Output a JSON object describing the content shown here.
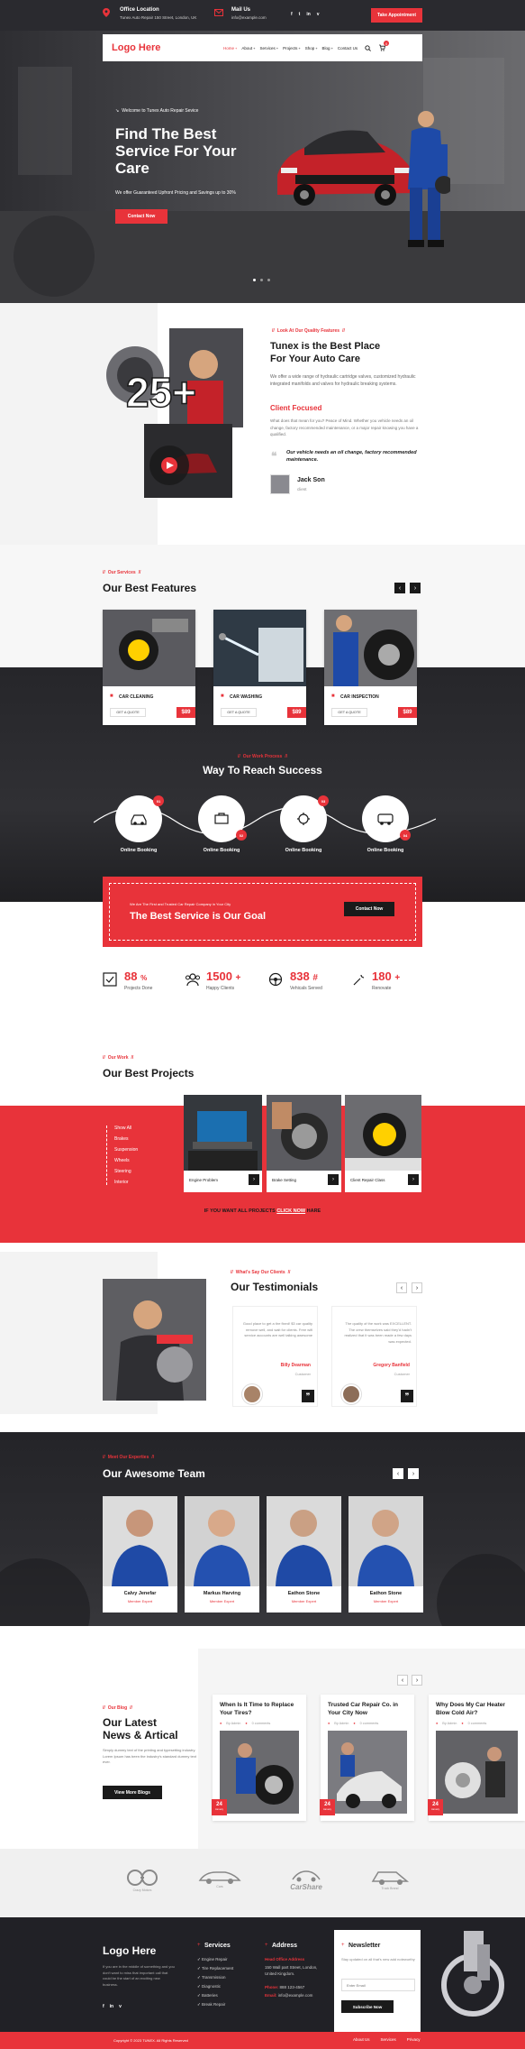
{
  "topbar": {
    "office_title": "Office Location",
    "office_text": "Tunex Auto Repair 150 Street, London, UK",
    "mail_title": "Mail Us",
    "mail_text": "info@example.com",
    "social": [
      "f",
      "t",
      "in",
      "v"
    ],
    "appointment": "Take Appointment"
  },
  "nav": {
    "logo": "Logo Here",
    "items": [
      "Home",
      "About",
      "Services",
      "Projects",
      "Shop",
      "Blog",
      "Contact Us"
    ],
    "cart_count": "0"
  },
  "hero": {
    "tag": "Welcome to Tunex Auto Repair Sevice",
    "title1": "Find The Best",
    "title2": "Service For Your",
    "title3": "Care",
    "sub": "We offer Guaranteed Upfront Pricing and Savings up to 30%",
    "button": "Contact Now"
  },
  "about": {
    "badge": "25+",
    "tag": "Look At Our Quality Features",
    "title1": "Tunex is the Best Place",
    "title2": "For Your Auto Care",
    "desc": "We offer a wide range of hydraulic cartridge valves, customized hydraulic integrated manifolds and valves for hydraulic breaking systems.",
    "subhead": "Client Focused",
    "desc2": "What does that mean for you? Peace of Mind. Whether you vehicle needs an oil change, factory recommended maintenance, or a major repair knowing you have a qualified.",
    "quote": "Our vehicle needs an oil change, factory recommended maintenance.",
    "author": "Jack Son",
    "author_role": "client"
  },
  "services": {
    "tag": "Our Services",
    "title": "Our Best Features",
    "cards": [
      {
        "name": "CAR CLEANING",
        "btn": "GET A QUOTE",
        "price": "$89"
      },
      {
        "name": "CAR WASHING",
        "btn": "GET A QUOTE",
        "price": "$89"
      },
      {
        "name": "CAR INSPECTION",
        "btn": "GET A QUOTE",
        "price": "$89"
      }
    ]
  },
  "process": {
    "tag": "Our Work Process",
    "title": "Way To Reach Success",
    "steps": [
      {
        "label": "Online Booking",
        "num": "01"
      },
      {
        "label": "Online Booking",
        "num": "02"
      },
      {
        "label": "Online Booking",
        "num": "03"
      },
      {
        "label": "Online Booking",
        "num": "04"
      }
    ]
  },
  "cta": {
    "small": "We Are The First and Trusted Car Repair Company in Your City",
    "title": "The Best Service is Our Goal",
    "button": "Contact Now"
  },
  "stats": [
    {
      "num": "88",
      "unit": "%",
      "label": "Projects Done"
    },
    {
      "num": "1500",
      "unit": "+",
      "label": "Happy Clients"
    },
    {
      "num": "838",
      "unit": "#",
      "label": "Vehicals Served"
    },
    {
      "num": "180",
      "unit": "+",
      "label": "Renovate"
    }
  ],
  "projects": {
    "tag": "Our Work",
    "title": "Our Best Projects",
    "filters": [
      "Show All",
      "Brakes",
      "Suspension",
      "Wheels",
      "Steering",
      "Interior"
    ],
    "items": [
      "Engine Problem",
      "Brake Setting",
      "Client Repair Class"
    ],
    "more_text": "IF YOU WANT ALL PROJECTS",
    "more_link": "CLICK NOW",
    "more_end": "HARE"
  },
  "testimonials": {
    "tag": "What's Say Our Clients",
    "title": "Our Testimonials",
    "items": [
      {
        "text": "Good place to get a tire fixed! $3 car quality remove well, and wait for clients. Free wifi service accounts are well talking awesome",
        "name": "Billy Dearman",
        "role": "Customer"
      },
      {
        "text": "The quality of the work was EXCELLENT. The crew themselves said they'd hadn't realized that it was been made a few days was expected.",
        "name": "Gregory Banfield",
        "role": "Customer"
      }
    ]
  },
  "team": {
    "tag": "Meet Our Experties",
    "title": "Our Awesome Team",
    "members": [
      {
        "name": "Calvy Jenefar",
        "role": "Member Expert"
      },
      {
        "name": "Markus Harving",
        "role": "Member Expert"
      },
      {
        "name": "Eathon Stone",
        "role": "Member Expert"
      },
      {
        "name": "Eathon Stone",
        "role": "Member Expert"
      }
    ]
  },
  "blog": {
    "tag": "Our Blog",
    "title1": "Our Latest",
    "title2": "News & Artical",
    "desc": "Simply dummy text of the printing and typesetting industry. Lorem Ipsum has been the industry's standard dummy text ever.",
    "button": "View More Blogs",
    "posts": [
      {
        "title": "When Is It Time to Replace Your Tires?",
        "author": "By Admin",
        "comments": "0 comments",
        "day": "24",
        "month": "January"
      },
      {
        "title": "Trusted Car Repair Co. in Your City Now",
        "author": "By Admin",
        "comments": "0 comments",
        "day": "24",
        "month": "January"
      },
      {
        "title": "Why Does My Car Heater Blow Cold Air?",
        "author": "By Admin",
        "comments": "0 comments",
        "day": "24",
        "month": "January"
      }
    ]
  },
  "brands": [
    "Crazy Motors",
    "Cars",
    "CarShare",
    "Truck Brand"
  ],
  "footer": {
    "logo": "Logo Here",
    "about": "If you are in the middle of something and you don't want to miss that important call that could be the start of an exciting new business.",
    "services_title": "Services",
    "services": [
      "Engine Repair",
      "Tire Replacement",
      "Transmission",
      "Diagnostic",
      "Batteries",
      "Break Repair"
    ],
    "address_title": "Address",
    "address_head": "Head Office Address",
    "address_text": "150 Wall part Street, London, United Kingdom.",
    "phone_label": "Phone:",
    "phone": "888 123-4567",
    "email_label": "Email:",
    "email": "info@example.com",
    "newsletter_title": "Newsletter",
    "newsletter_text": "Stay updated on all that's new add noteworthy",
    "newsletter_placeholder": "Enter Email",
    "newsletter_button": "Subscribe Now",
    "copyright": "Copyright © 2023 TUNEX. All Rights Reserved",
    "bottom_links": [
      "About Us",
      "Services",
      "Privacy"
    ]
  },
  "colors": {
    "accent": "#e8333a",
    "dark": "#1f1f24"
  }
}
